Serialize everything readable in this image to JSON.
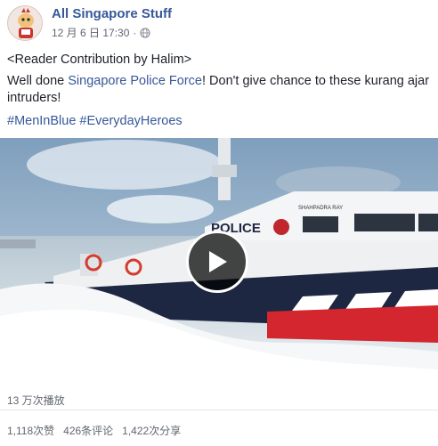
{
  "header": {
    "page_name": "All Singapore Stuff",
    "date": "12 月 6 日 17:30",
    "separator": "·"
  },
  "post": {
    "line1": "<Reader Contribution by Halim>",
    "line2_pre": "Well done ",
    "line2_link": "Singapore Police Force",
    "line2_post": "! Don't give chance to these kurang ajar intruders!",
    "hashtags": "#MenInBlue #EverydayHeroes"
  },
  "video": {
    "boat_label": "POLICE",
    "boat_name": "SHAHPADRA RAY"
  },
  "footer": {
    "views": "13 万次播放",
    "likes": "1,118次赞",
    "comments": "426条评论",
    "shares": "1,422次分享"
  },
  "colors": {
    "link": "#365899",
    "meta": "#616770"
  }
}
